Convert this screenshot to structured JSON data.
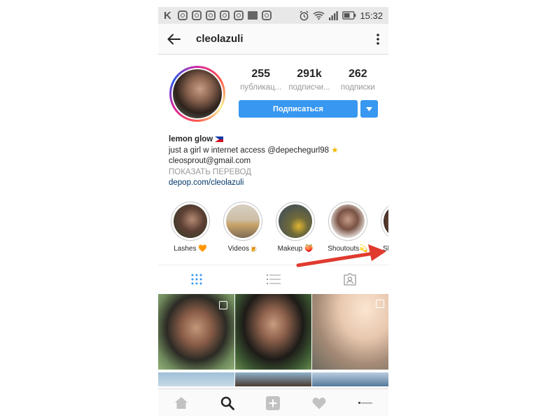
{
  "status_bar": {
    "left_letter": "K",
    "time": "15:32"
  },
  "header": {
    "username": "cleolazuli"
  },
  "profile": {
    "stats": [
      {
        "value": "255",
        "label": "публикац..."
      },
      {
        "value": "291k",
        "label": "подписчи..."
      },
      {
        "value": "262",
        "label": "подписки"
      }
    ],
    "subscribe_label": "Подписаться"
  },
  "bio": {
    "name": "lemon glow",
    "line1": "just a girl w internet access @depechegurl98",
    "email": "cleosprout@gmail.com",
    "translate": "ПОКАЗАТЬ ПЕРЕВОД",
    "link": "depop.com/cleolazuli"
  },
  "highlights": [
    {
      "label": "Lashes 🧡"
    },
    {
      "label": "Videos🍺"
    },
    {
      "label": "Makeup 🍑"
    },
    {
      "label": "Shoutouts💫"
    },
    {
      "label": "Sh"
    }
  ],
  "colors": {
    "accent": "#3897f0",
    "arrow": "#e03a2f",
    "link": "#003569"
  },
  "icons": [
    "back-arrow-icon",
    "more-dots-icon",
    "grid-icon",
    "list-icon",
    "tagged-icon",
    "home-icon",
    "search-icon",
    "add-icon",
    "heart-icon",
    "profile-icon"
  ]
}
